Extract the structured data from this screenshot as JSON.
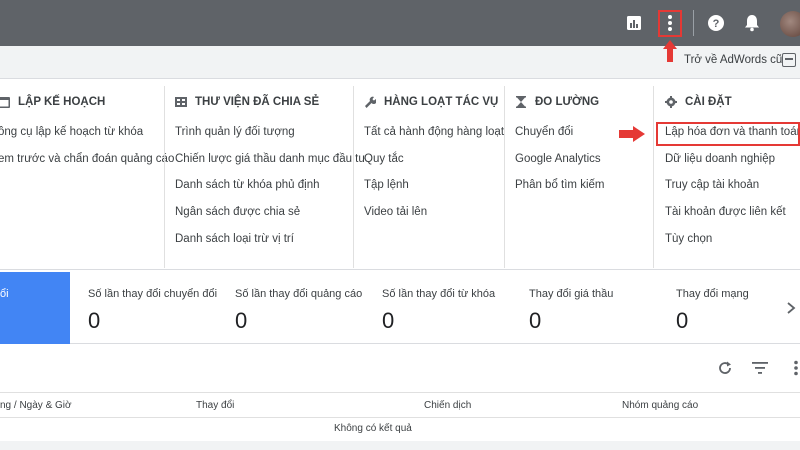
{
  "topbar": {
    "icons": [
      "bar-chart-icon",
      "more-vert-icon",
      "help-icon",
      "bell-icon",
      "avatar"
    ]
  },
  "subbar": {
    "old_adwords_link": "Trở về AdWords cũ"
  },
  "menu": {
    "columns": [
      {
        "key": "planning",
        "icon": "calendar-icon",
        "title": "LẬP KẾ HOẠCH",
        "items": [
          "ông cụ lập kế hoạch từ khóa",
          "em trước và chẩn đoán quảng cáo"
        ]
      },
      {
        "key": "shared-library",
        "icon": "library-icon",
        "title": "THƯ VIỆN ĐÃ CHIA SẺ",
        "items": [
          "Trình quản lý đối tượng",
          "Chiến lược giá thầu danh mục đầu tư",
          "Danh sách từ khóa phủ định",
          "Ngân sách được chia sẻ",
          "Danh sách loại trừ vị trí"
        ]
      },
      {
        "key": "bulk-actions",
        "icon": "wrench-icon",
        "title": "HÀNG LOẠT TÁC VỤ",
        "items": [
          "Tất cả hành động hàng loạt",
          "Quy tắc",
          "Tập lệnh",
          "Video tải lên"
        ]
      },
      {
        "key": "measurement",
        "icon": "hourglass-icon",
        "title": "ĐO LƯỜNG",
        "items": [
          "Chuyển đổi",
          "Google Analytics",
          "Phân bổ tìm kiếm"
        ]
      },
      {
        "key": "settings",
        "icon": "gear-icon",
        "title": "CÀI ĐẶT",
        "items": [
          "Lập hóa đơn và thanh toán",
          "Dữ liệu doanh nghiệp",
          "Truy cập tài khoản",
          "Tài khoản được liên kết",
          "Tùy chọn"
        ]
      }
    ]
  },
  "stats": {
    "active_label": "ổi",
    "cards": [
      {
        "label": "Số lần thay đổi chuyển đổi",
        "value": "0"
      },
      {
        "label": "Số lần thay đổi quảng cáo",
        "value": "0"
      },
      {
        "label": "Số lần thay đổi từ khóa",
        "value": "0"
      },
      {
        "label": "Thay đổi giá thầu",
        "value": "0"
      },
      {
        "label": "Thay đổi mạng",
        "value": "0"
      }
    ]
  },
  "table": {
    "headers": [
      "ng / Ngày & Giờ",
      "Thay đổi",
      "Chiến dịch",
      "Nhóm quảng cáo"
    ],
    "empty_text": "Không có kết quả"
  },
  "colors": {
    "topbar": "#5f6368",
    "accent_blue": "#4285f4",
    "highlight_red": "#e53935"
  }
}
